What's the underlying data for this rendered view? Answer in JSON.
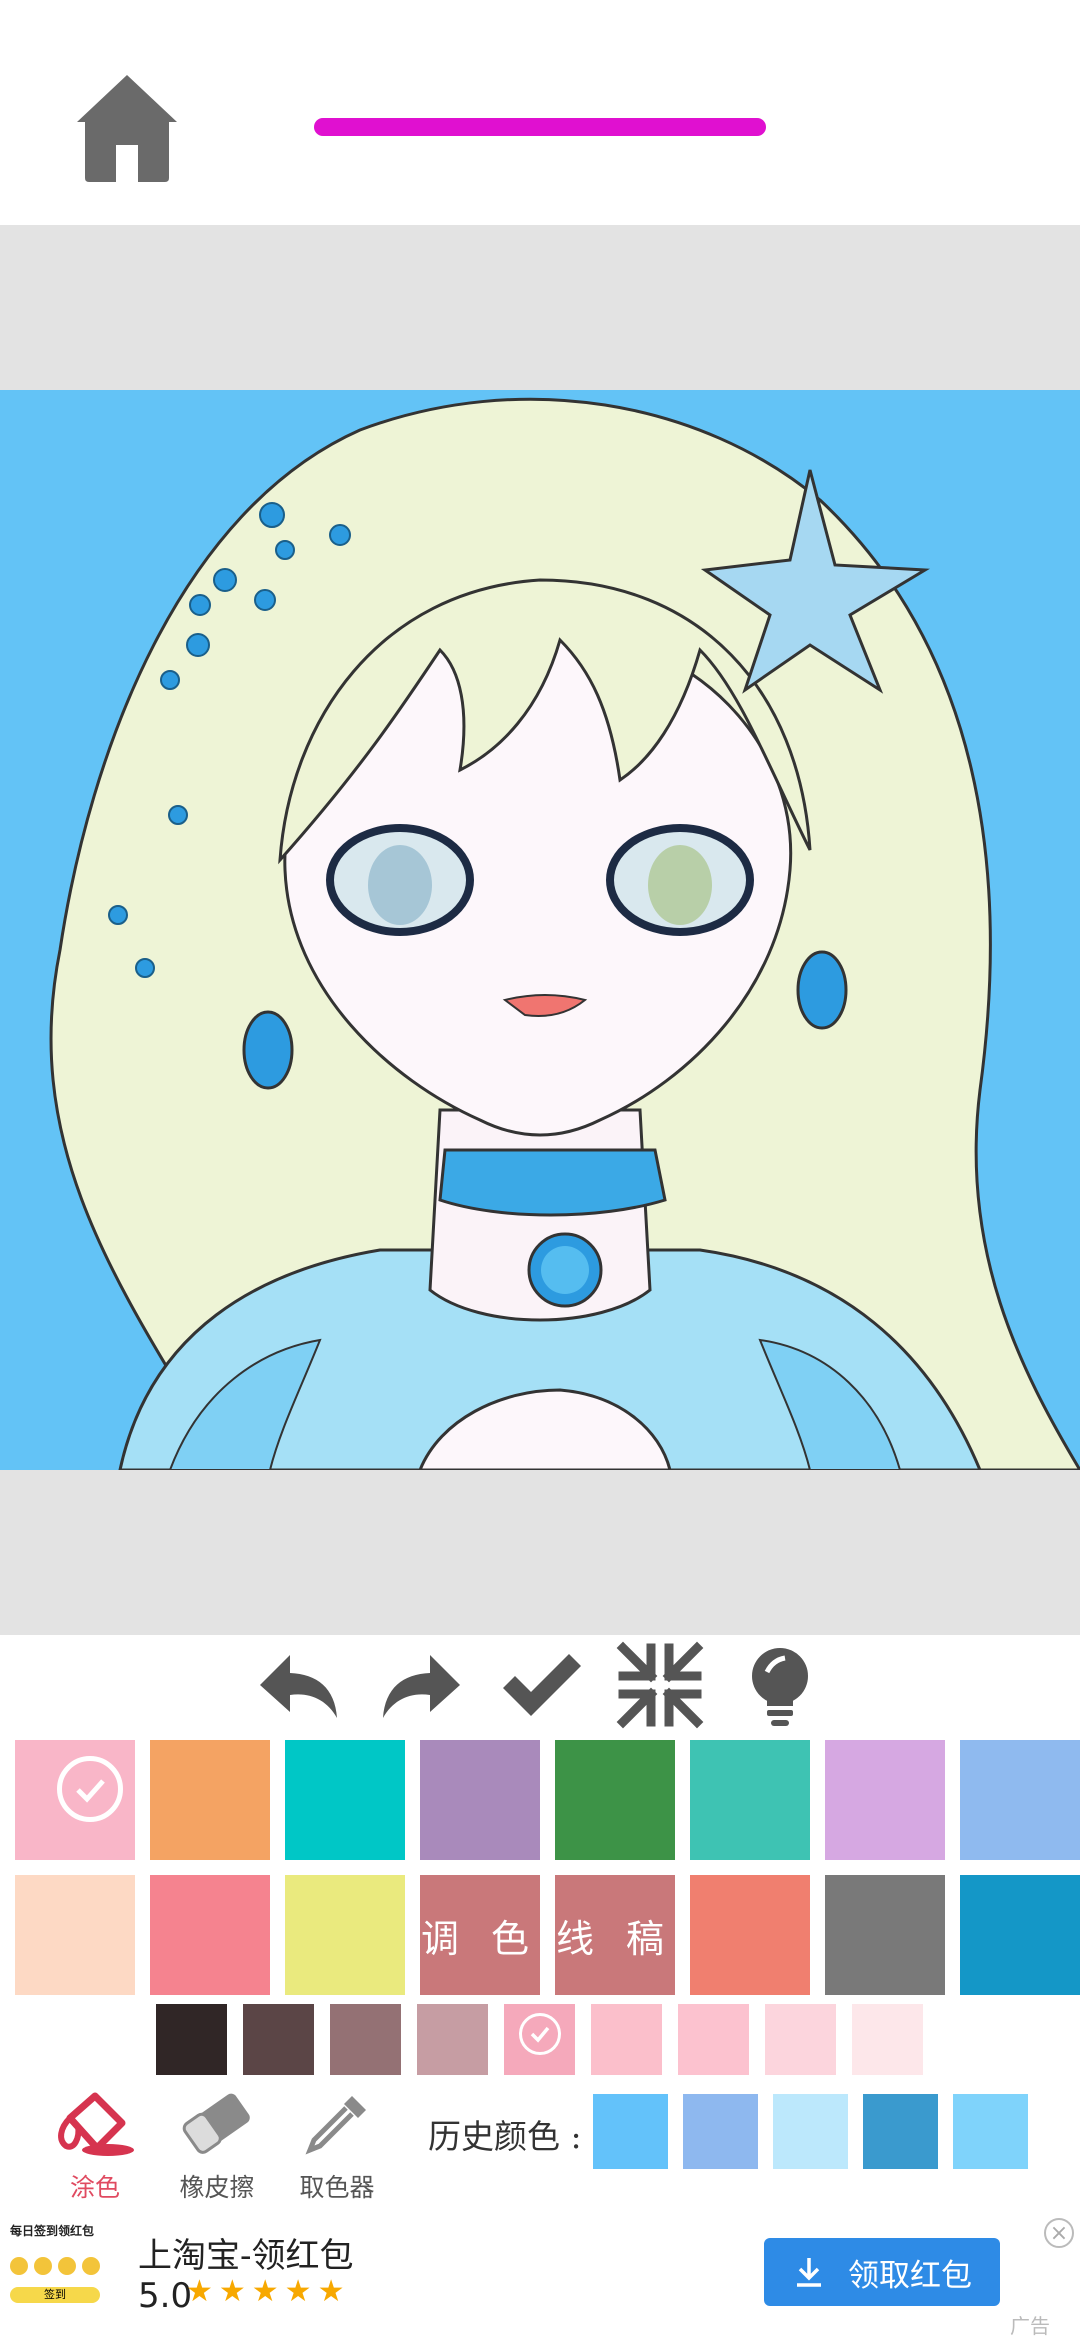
{
  "progress": {
    "fraction": 1.0,
    "color": "#e010d0"
  },
  "toolbar_icons": [
    "undo-icon",
    "redo-icon",
    "check-icon",
    "compress-icon",
    "lightbulb-icon"
  ],
  "palette": {
    "row1": [
      "#f9b6c8",
      "#f4a363",
      "#00c7c6",
      "#a98abb",
      "#3d9347",
      "#3ec3b3",
      "#d6a8e2",
      "#8fbaef"
    ],
    "row1_selected_index": 0,
    "row2": [
      {
        "color": "#fdd9c4"
      },
      {
        "color": "#f5838f"
      },
      {
        "color": "#eaea7e"
      },
      {
        "color": "#c9787a",
        "label": "调 色"
      },
      {
        "color": "#c9787a",
        "label": "线 稿"
      },
      {
        "color": "#f07f6f"
      },
      {
        "color": "#797979"
      },
      {
        "color": "#1497c7"
      }
    ],
    "shades": [
      "#302626",
      "#5b4546",
      "#947174",
      "#c69da3",
      "#f5a9bb",
      "#fbbfcb",
      "#fcc2cf",
      "#fcd5dd",
      "#fde7ea"
    ],
    "shade_selected_index": 4
  },
  "bottom_tools": [
    {
      "label": "涂色",
      "icon": "paint-bucket-icon",
      "active": true
    },
    {
      "label": "橡皮擦",
      "icon": "eraser-icon",
      "active": false
    },
    {
      "label": "取色器",
      "icon": "eyedropper-icon",
      "active": false
    }
  ],
  "history": {
    "label": "历史颜色 :",
    "colors": [
      "#63c2fa",
      "#8eb8ef",
      "#bce8fc",
      "#3a9ace",
      "#7fd3fb"
    ]
  },
  "ad": {
    "thumb_title": "每日签到领红包",
    "thumb_button": "签到",
    "title": "上淘宝-领红包",
    "rating": "5.0",
    "stars": "★★★★★",
    "button_label": "领取红包",
    "close": "×",
    "tag": "广告"
  }
}
